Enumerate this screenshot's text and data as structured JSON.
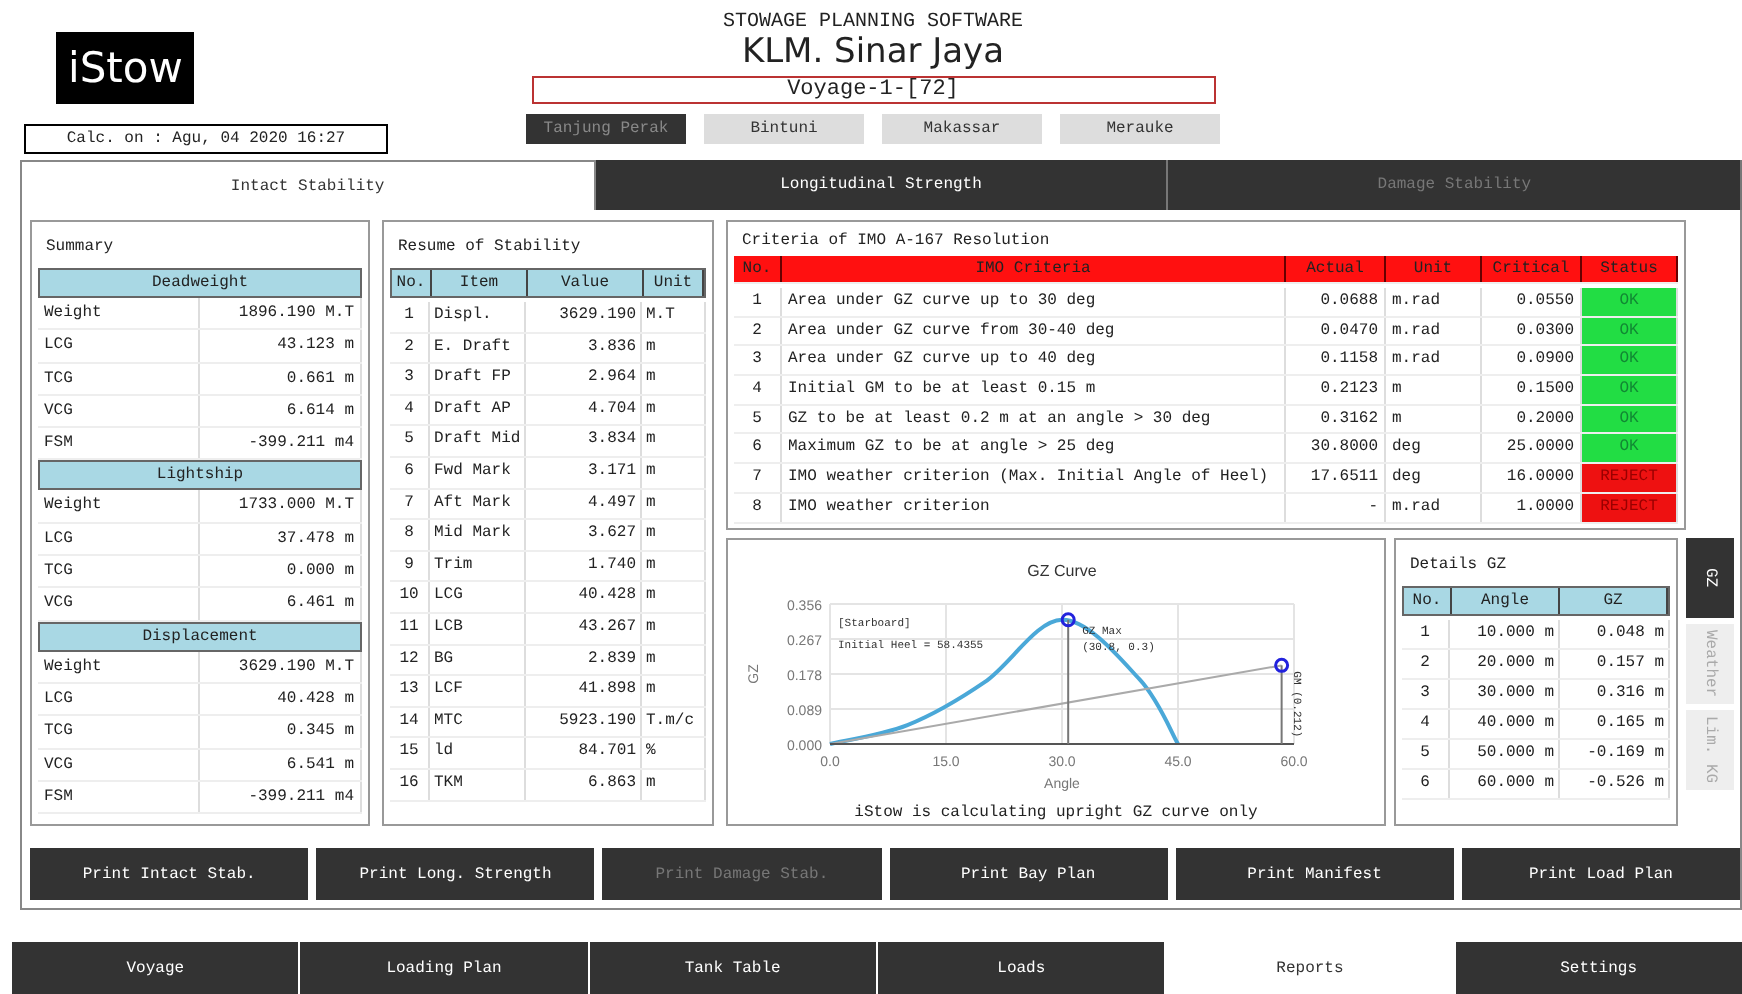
{
  "header": {
    "logo": "iStow",
    "calc": "Calc. on : Agu, 04 2020 16:27",
    "software": "STOWAGE PLANNING SOFTWARE",
    "ship": "KLM. Sinar Jaya",
    "voyage": "Voyage-1-[72]",
    "ports": [
      {
        "label": "Tanjung Perak",
        "selected": true
      },
      {
        "label": "Bintuni",
        "selected": false
      },
      {
        "label": "Makassar",
        "selected": false
      },
      {
        "label": "Merauke",
        "selected": false
      }
    ]
  },
  "tabs": [
    {
      "label": "Intact Stability",
      "selected": true,
      "disabled": false
    },
    {
      "label": "Longitudinal Strength",
      "selected": false,
      "disabled": false
    },
    {
      "label": "Damage Stability",
      "selected": false,
      "disabled": true
    }
  ],
  "summary": {
    "title": "Summary",
    "groups": [
      {
        "title": "Deadweight",
        "rows": [
          {
            "label": "Weight",
            "value": "1896.190 M.T"
          },
          {
            "label": "LCG",
            "value": "43.123 m"
          },
          {
            "label": "TCG",
            "value": "0.661 m"
          },
          {
            "label": "VCG",
            "value": "6.614 m"
          },
          {
            "label": "FSM",
            "value": "-399.211 m4"
          }
        ]
      },
      {
        "title": "Lightship",
        "rows": [
          {
            "label": "Weight",
            "value": "1733.000 M.T"
          },
          {
            "label": "LCG",
            "value": "37.478 m"
          },
          {
            "label": "TCG",
            "value": "0.000 m"
          },
          {
            "label": "VCG",
            "value": "6.461 m"
          }
        ]
      },
      {
        "title": "Displacement",
        "rows": [
          {
            "label": "Weight",
            "value": "3629.190 M.T"
          },
          {
            "label": "LCG",
            "value": "40.428 m"
          },
          {
            "label": "TCG",
            "value": "0.345 m"
          },
          {
            "label": "VCG",
            "value": "6.541 m"
          },
          {
            "label": "FSM",
            "value": "-399.211 m4"
          }
        ]
      }
    ]
  },
  "resume": {
    "title": "Resume of Stability",
    "columns": [
      "No.",
      "Item",
      "Value",
      "Unit"
    ],
    "rows": [
      {
        "no": "1",
        "item": "Displ.",
        "value": "3629.190",
        "unit": "M.T"
      },
      {
        "no": "2",
        "item": "E. Draft",
        "value": "3.836",
        "unit": "m"
      },
      {
        "no": "3",
        "item": "Draft FP",
        "value": "2.964",
        "unit": "m"
      },
      {
        "no": "4",
        "item": "Draft AP",
        "value": "4.704",
        "unit": "m"
      },
      {
        "no": "5",
        "item": "Draft Mid",
        "value": "3.834",
        "unit": "m"
      },
      {
        "no": "6",
        "item": "Fwd Mark",
        "value": "3.171",
        "unit": "m"
      },
      {
        "no": "7",
        "item": "Aft Mark",
        "value": "4.497",
        "unit": "m"
      },
      {
        "no": "8",
        "item": "Mid Mark",
        "value": "3.627",
        "unit": "m"
      },
      {
        "no": "9",
        "item": "Trim",
        "value": "1.740",
        "unit": "m"
      },
      {
        "no": "10",
        "item": "LCG",
        "value": "40.428",
        "unit": "m"
      },
      {
        "no": "11",
        "item": "LCB",
        "value": "43.267",
        "unit": "m"
      },
      {
        "no": "12",
        "item": "BG",
        "value": "2.839",
        "unit": "m"
      },
      {
        "no": "13",
        "item": "LCF",
        "value": "41.898",
        "unit": "m"
      },
      {
        "no": "14",
        "item": "MTC",
        "value": "5923.190",
        "unit": "T.m/c"
      },
      {
        "no": "15",
        "item": "ld",
        "value": "84.701",
        "unit": "%"
      },
      {
        "no": "16",
        "item": "TKM",
        "value": "6.863",
        "unit": "m"
      }
    ]
  },
  "criteria": {
    "title": "Criteria of IMO A-167 Resolution",
    "columns": [
      "No.",
      "IMO Criteria",
      "Actual",
      "Unit",
      "Critical",
      "Status"
    ],
    "rows": [
      {
        "no": "1",
        "criterion": "Area under GZ curve up to 30 deg",
        "actual": "0.0688",
        "unit": "m.rad",
        "critical": "0.0550",
        "status": "OK",
        "pass": true
      },
      {
        "no": "2",
        "criterion": "Area under GZ curve from 30-40 deg",
        "actual": "0.0470",
        "unit": "m.rad",
        "critical": "0.0300",
        "status": "OK",
        "pass": true
      },
      {
        "no": "3",
        "criterion": "Area under GZ curve up to 40 deg",
        "actual": "0.1158",
        "unit": "m.rad",
        "critical": "0.0900",
        "status": "OK",
        "pass": true
      },
      {
        "no": "4",
        "criterion": "Initial GM to be at least 0.15 m",
        "actual": "0.2123",
        "unit": "m",
        "critical": "0.1500",
        "status": "OK",
        "pass": true
      },
      {
        "no": "5",
        "criterion": "GZ to be at least 0.2 m at an angle > 30 deg",
        "actual": "0.3162",
        "unit": "m",
        "critical": "0.2000",
        "status": "OK",
        "pass": true
      },
      {
        "no": "6",
        "criterion": "Maximum GZ to be at angle > 25 deg",
        "actual": "30.8000",
        "unit": "deg",
        "critical": "25.0000",
        "status": "OK",
        "pass": true
      },
      {
        "no": "7",
        "criterion": "IMO weather criterion (Max. Initial Angle of Heel)",
        "actual": "17.6511",
        "unit": "deg",
        "critical": "16.0000",
        "status": "REJECT",
        "pass": false
      },
      {
        "no": "8",
        "criterion": "IMO weather criterion",
        "actual": "-",
        "unit": "m.rad",
        "critical": "1.0000",
        "status": "REJECT",
        "pass": false
      }
    ]
  },
  "gz_panel": {
    "note": "iStow is calculating upright GZ curve only",
    "chart_data": {
      "type": "line",
      "title": "GZ Curve",
      "xlabel": "Angle",
      "ylabel": "GZ",
      "x": [
        0,
        10,
        20,
        30,
        40,
        45,
        58.4
      ],
      "series": [
        {
          "color": "#4aa8d8",
          "values": [
            0,
            0.048,
            0.157,
            0.316,
            0.165,
            0,
            null
          ]
        },
        {
          "color": "#aaaaaa",
          "values": [
            0,
            null,
            null,
            null,
            null,
            null,
            0.2
          ]
        }
      ],
      "xlim": [
        0,
        60
      ],
      "ylim": [
        0,
        0.356
      ],
      "grid": true,
      "xticks": [
        {
          "value": 0,
          "label": "0.0"
        },
        {
          "value": 15,
          "label": "15.0"
        },
        {
          "value": 30,
          "label": "30.0"
        },
        {
          "value": 45,
          "label": "45.0"
        },
        {
          "value": 60,
          "label": "60.0"
        }
      ],
      "yticks": [
        {
          "value": 0,
          "label": "0.000"
        },
        {
          "value": 0.089,
          "label": "0.089"
        },
        {
          "value": 0.178,
          "label": "0.178"
        },
        {
          "value": 0.267,
          "label": "0.267"
        },
        {
          "value": 0.356,
          "label": "0.356"
        }
      ],
      "ref_lines": [
        {
          "axis": "x",
          "value": 30.8
        },
        {
          "axis": "x",
          "value": 58.4
        }
      ],
      "annotations": [
        "[Starboard]",
        "Initial Heel = 58.4355",
        {
          "text": "GZ Max",
          "x": 30.8,
          "y": 0.316
        },
        "(30.8, 0.3)",
        {
          "text": "GM (0.212)",
          "x": 58.4,
          "y": 0.2
        }
      ]
    }
  },
  "details": {
    "title": "Details GZ",
    "columns": [
      "No.",
      "Angle",
      "GZ"
    ],
    "rows": [
      {
        "no": "1",
        "angle": "10.000 m",
        "gz": "0.048 m"
      },
      {
        "no": "2",
        "angle": "20.000 m",
        "gz": "0.157 m"
      },
      {
        "no": "3",
        "angle": "30.000 m",
        "gz": "0.316 m"
      },
      {
        "no": "4",
        "angle": "40.000 m",
        "gz": "0.165 m"
      },
      {
        "no": "5",
        "angle": "50.000 m",
        "gz": "-0.169 m"
      },
      {
        "no": "6",
        "angle": "60.000 m",
        "gz": "-0.526 m"
      }
    ]
  },
  "side_tabs": [
    {
      "label": "GZ",
      "selected": true
    },
    {
      "label": "Weather",
      "selected": false
    },
    {
      "label": "Lim. KG",
      "selected": false
    }
  ],
  "print_buttons": [
    {
      "label": "Print Intact Stab.",
      "disabled": false
    },
    {
      "label": "Print Long. Strength",
      "disabled": false
    },
    {
      "label": "Print Damage Stab.",
      "disabled": true
    },
    {
      "label": "Print Bay Plan",
      "disabled": false
    },
    {
      "label": "Print Manifest",
      "disabled": false
    },
    {
      "label": "Print Load Plan",
      "disabled": false
    }
  ],
  "nav": [
    {
      "label": "Voyage",
      "selected": false
    },
    {
      "label": "Loading Plan",
      "selected": false
    },
    {
      "label": "Tank Table",
      "selected": false
    },
    {
      "label": "Loads",
      "selected": false
    },
    {
      "label": "Reports",
      "selected": true
    },
    {
      "label": "Settings",
      "selected": false
    }
  ]
}
